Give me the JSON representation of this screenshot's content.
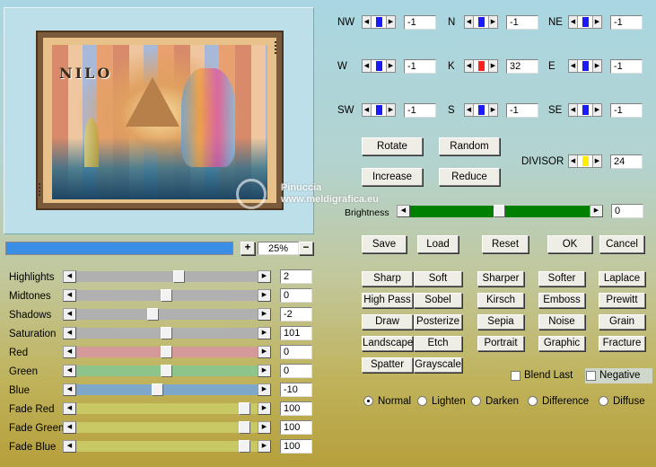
{
  "preview": {
    "logo_text": "NILO",
    "watermark_name": "Pinuccia",
    "watermark_url": "www.meldigrafica.eu"
  },
  "zoom": {
    "plus": "+",
    "minus": "−",
    "value": "25%",
    "progress": 1.0
  },
  "directions": [
    {
      "label": "NW",
      "value": "-1",
      "color": "#1a1aff"
    },
    {
      "label": "N",
      "value": "-1",
      "color": "#1a1aff"
    },
    {
      "label": "NE",
      "value": "-1",
      "color": "#1a1aff"
    },
    {
      "label": "W",
      "value": "-1",
      "color": "#1a1aff"
    },
    {
      "label": "K",
      "value": "32",
      "color": "#ff2020"
    },
    {
      "label": "E",
      "value": "-1",
      "color": "#1a1aff"
    },
    {
      "label": "SW",
      "value": "-1",
      "color": "#1a1aff"
    },
    {
      "label": "S",
      "value": "-1",
      "color": "#1a1aff"
    },
    {
      "label": "SE",
      "value": "-1",
      "color": "#1a1aff"
    }
  ],
  "buttons": {
    "rotate": "Rotate",
    "random": "Random",
    "increase": "Increase",
    "reduce": "Reduce",
    "save": "Save",
    "load": "Load",
    "reset": "Reset",
    "ok": "OK",
    "cancel": "Cancel"
  },
  "divisor": {
    "label": "DIVISOR",
    "value": "24",
    "color": "#ffee00"
  },
  "brightness": {
    "label": "Brightness",
    "value": "0",
    "level": 0.5,
    "color": "#008000"
  },
  "filters": [
    [
      "Sharp",
      "Soft",
      "Sharper",
      "Softer",
      "Laplace"
    ],
    [
      "High Pass",
      "Sobel",
      "Kirsch",
      "Emboss",
      "Prewitt"
    ],
    [
      "Draw",
      "Posterize",
      "Sepia",
      "Noise",
      "Grain"
    ],
    [
      "Landscape",
      "Etch",
      "Portrait",
      "Graphic",
      "Fracture"
    ],
    [
      "Spatter",
      "Grayscale"
    ]
  ],
  "options": {
    "blend_last": "Blend Last",
    "negative": "Negative"
  },
  "modes": [
    "Normal",
    "Lighten",
    "Darken",
    "Difference",
    "Diffuse"
  ],
  "selected_mode": "Normal",
  "sliders": [
    {
      "label": "Highlights",
      "value": "2",
      "pos": 0.58,
      "color": "#b0b0b0"
    },
    {
      "label": "Midtones",
      "value": "0",
      "pos": 0.5,
      "color": "#b0b0b0"
    },
    {
      "label": "Shadows",
      "value": "-2",
      "pos": 0.42,
      "color": "#b0b0b0"
    },
    {
      "label": "Saturation",
      "value": "101",
      "pos": 0.5,
      "color": "#b0b0b0"
    },
    {
      "label": "Red",
      "value": "0",
      "pos": 0.5,
      "color": "#d49a9a"
    },
    {
      "label": "Green",
      "value": "0",
      "pos": 0.5,
      "color": "#8cc48c"
    },
    {
      "label": "Blue",
      "value": "-10",
      "pos": 0.45,
      "color": "#7ea7c9"
    },
    {
      "label": "Fade Red",
      "value": "100",
      "pos": 0.97,
      "color": "#c8c864"
    },
    {
      "label": "Fade Green",
      "value": "100",
      "pos": 0.97,
      "color": "#c8c864"
    },
    {
      "label": "Fade Blue",
      "value": "100",
      "pos": 0.97,
      "color": "#c8c864"
    }
  ]
}
